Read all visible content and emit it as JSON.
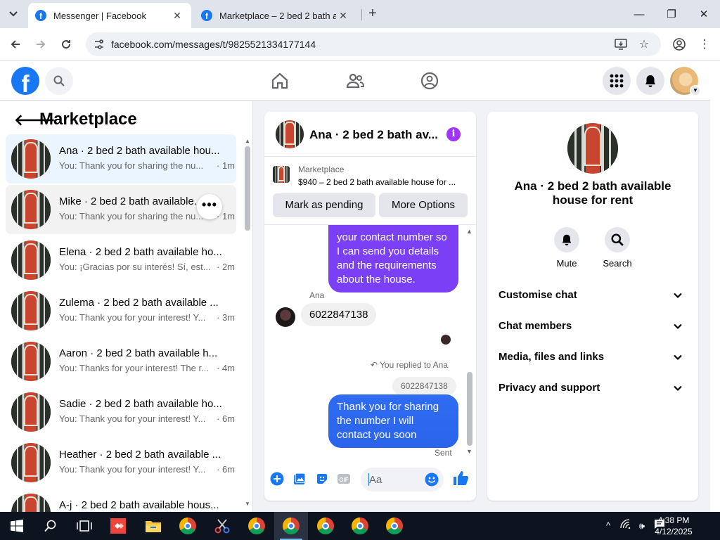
{
  "browser": {
    "tabs": [
      {
        "title": "Messenger | Facebook",
        "active": true
      },
      {
        "title": "Marketplace – 2 bed 2 bath ava",
        "active": false
      }
    ],
    "url": "facebook.com/messages/t/9825521334177144"
  },
  "left": {
    "title": "Marketplace",
    "chats": [
      {
        "name": "Ana · 2 bed 2 bath available hou...",
        "preview": "You: Thank you for sharing the nu...",
        "time": "· 1m"
      },
      {
        "name": "Mike · 2 bed 2 bath available...",
        "preview": "You: Thank you for sharing the nu...",
        "time": "· 1m"
      },
      {
        "name": "Elena · 2 bed 2 bath available ho...",
        "preview": "You: ¡Gracias por su interés! Sí, est...",
        "time": "· 2m"
      },
      {
        "name": "Zulema · 2 bed 2 bath available ...",
        "preview": "You: Thank you for your interest! Y...",
        "time": "· 3m"
      },
      {
        "name": "Aaron · 2 bed 2 bath available h...",
        "preview": "You: Thanks for your interest! The r...",
        "time": "· 4m"
      },
      {
        "name": "Sadie · 2 bed 2 bath available ho...",
        "preview": "You: Thank you for your interest! Y...",
        "time": "· 6m"
      },
      {
        "name": "Heather · 2 bed 2 bath available ...",
        "preview": "You: Thank you for your interest! Y...",
        "time": "· 6m"
      },
      {
        "name": "A-j · 2 bed 2 bath available hous...",
        "preview": "",
        "time": ""
      }
    ],
    "more_dots": "•••"
  },
  "conversation": {
    "header_name": "Ana · 2 bed 2 bath av...",
    "marketplace_label": "Marketplace",
    "listing_title": "$940 – 2 bed 2 bath available house for ...",
    "mark_pending": "Mark as pending",
    "more_options": "More Options",
    "msg_partial": "your contact number so I can send you details and the requirements about the house.",
    "sender_name": "Ana",
    "their_message": "6022847138",
    "reply_label": "You replied to Ana",
    "quoted_text": "6022847138",
    "my_reply": "Thank you for sharing the number I will contact you soon",
    "status": "Sent",
    "composer_placeholder": "Aa"
  },
  "info": {
    "name": "Ana · 2 bed 2 bath available house for rent",
    "actions": [
      {
        "label": "Mute"
      },
      {
        "label": "Search"
      }
    ],
    "sections": [
      "Customise chat",
      "Chat members",
      "Media, files and links",
      "Privacy and support"
    ]
  },
  "taskbar": {
    "time": "4:38 PM",
    "date": "4/12/2025"
  },
  "colors": {
    "fb_blue": "#1877f2",
    "my_bubble_purple": "#7b3ff6",
    "my_bubble_blue": "#2f6cf0",
    "selected_chat": "#ebf5ff"
  }
}
